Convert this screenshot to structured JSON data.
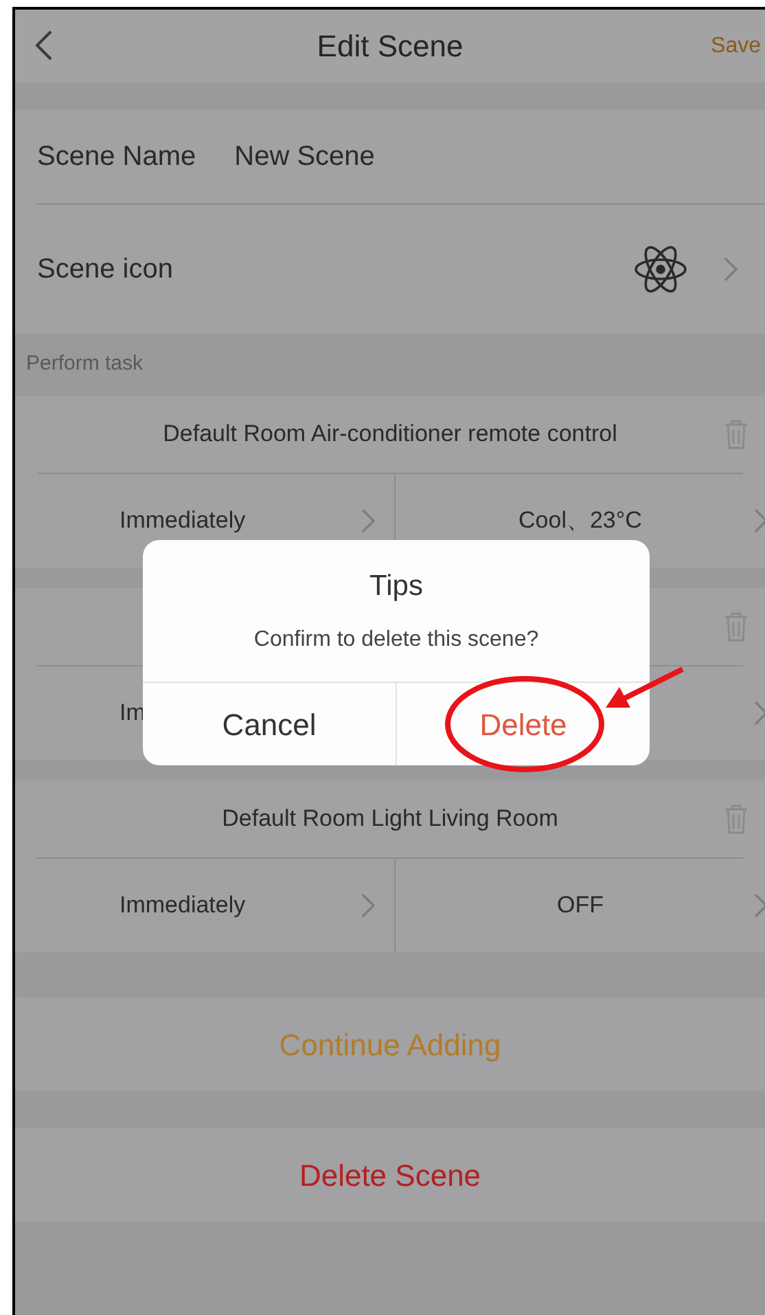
{
  "nav": {
    "title": "Edit Scene",
    "action": "Save"
  },
  "scene_fields": [
    {
      "kind": "text",
      "label": "Scene Name",
      "value": "New Scene"
    },
    {
      "kind": "icon",
      "label": "Scene icon"
    }
  ],
  "section_header": "Perform task",
  "tasks": [
    {
      "title": "Default Room Air-conditioner remote control",
      "timing": "Immediately",
      "setting": "Cool、23°C"
    },
    {
      "timing": "Im"
    },
    {
      "title": "Default Room Light Living Room",
      "timing": "Immediately",
      "setting": "OFF"
    }
  ],
  "actions": [
    {
      "kind": "add",
      "label": "Continue Adding"
    },
    {
      "kind": "delete",
      "label": "Delete Scene"
    }
  ],
  "dialog": {
    "title": "Tips",
    "message": "Confirm to delete this scene?",
    "buttons": [
      {
        "kind": "cancel",
        "label": "Cancel"
      },
      {
        "kind": "destructive",
        "label": "Delete"
      }
    ]
  }
}
